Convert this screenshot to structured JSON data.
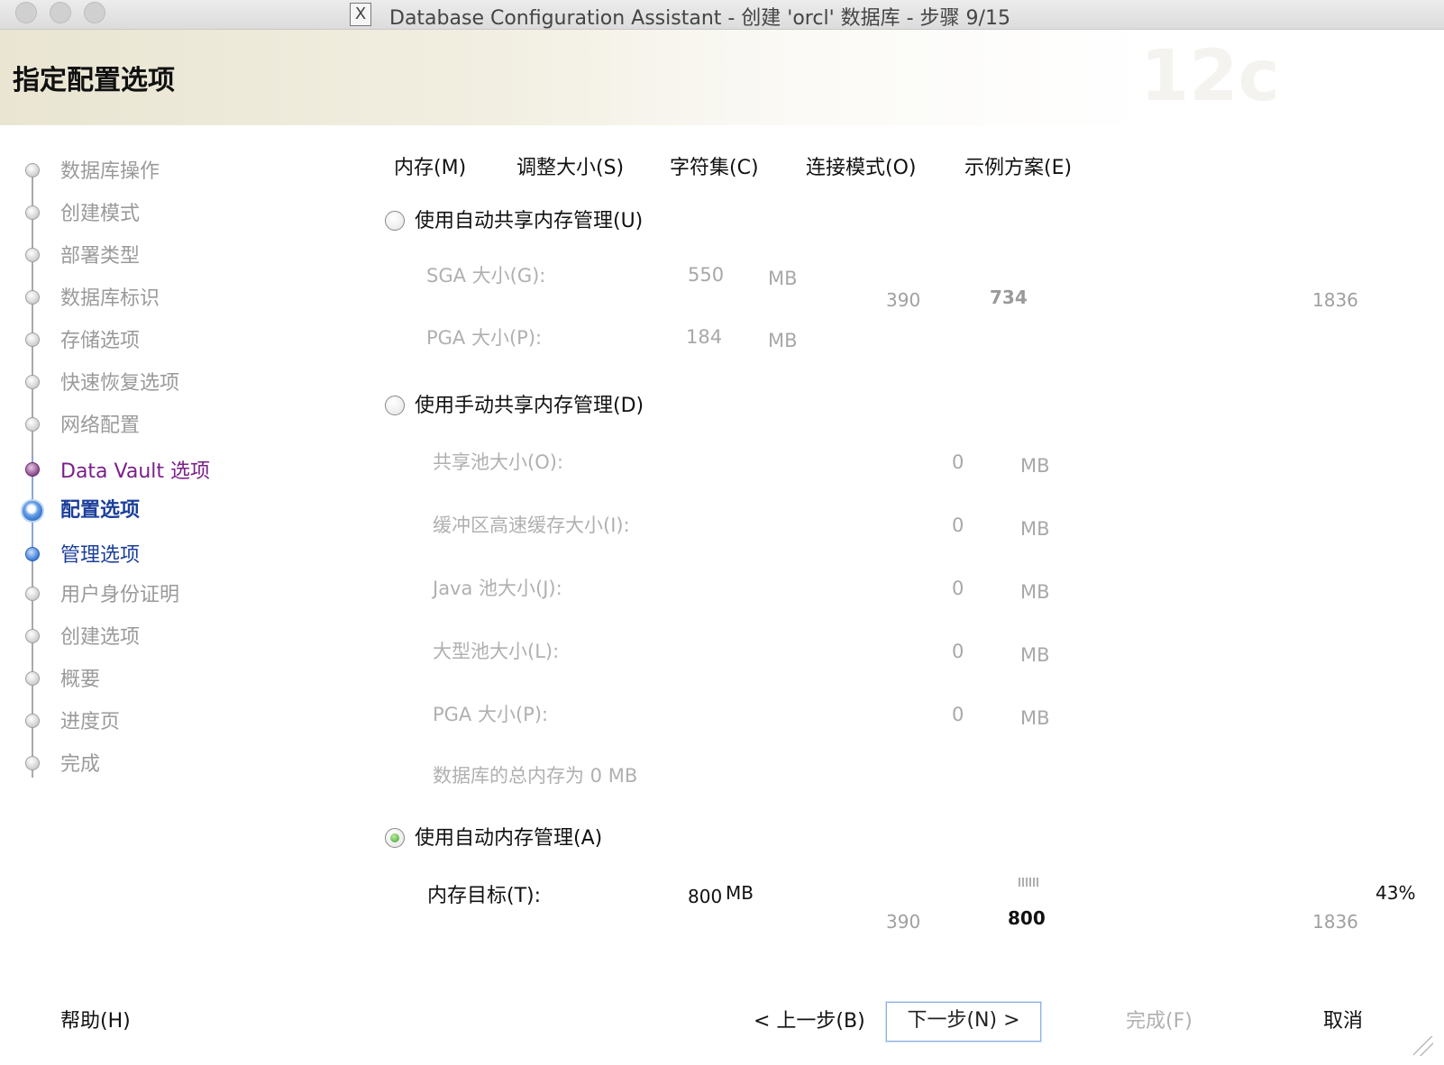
{
  "window": {
    "title": "Database Configuration Assistant - 创建 'orcl' 数据库 - 步骤 9/15",
    "title_icon": "X"
  },
  "header": {
    "title": "指定配置选项",
    "watermark": "12c"
  },
  "steps": [
    {
      "label": "数据库操作",
      "state": "done"
    },
    {
      "label": "创建模式",
      "state": "done"
    },
    {
      "label": "部署类型",
      "state": "done"
    },
    {
      "label": "数据库标识",
      "state": "done"
    },
    {
      "label": "存储选项",
      "state": "done"
    },
    {
      "label": "快速恢复选项",
      "state": "done"
    },
    {
      "label": "网络配置",
      "state": "done"
    },
    {
      "label": "Data Vault 选项",
      "state": "visited"
    },
    {
      "label": "配置选项",
      "state": "current"
    },
    {
      "label": "管理选项",
      "state": "next"
    },
    {
      "label": "用户身份证明",
      "state": "pending"
    },
    {
      "label": "创建选项",
      "state": "pending"
    },
    {
      "label": "概要",
      "state": "pending"
    },
    {
      "label": "进度页",
      "state": "pending"
    },
    {
      "label": "完成",
      "state": "pending"
    }
  ],
  "tabs": [
    {
      "label": "内存(M)"
    },
    {
      "label": "调整大小(S)"
    },
    {
      "label": "字符集(C)"
    },
    {
      "label": "连接模式(O)"
    },
    {
      "label": "示例方案(E)"
    }
  ],
  "memory": {
    "asmm": {
      "label": "使用自动共享内存管理(U)",
      "selected": false,
      "sga_label": "SGA 大小(G):",
      "sga_value": "550",
      "sga_unit": "MB",
      "pga_label": "PGA 大小(P):",
      "pga_value": "184",
      "pga_unit": "MB",
      "scale_min": "390",
      "scale_mid": "734",
      "scale_max": "1836"
    },
    "manual": {
      "label": "使用手动共享内存管理(D)",
      "selected": false,
      "fields": [
        {
          "label": "共享池大小(O):",
          "value": "0",
          "unit": "MB"
        },
        {
          "label": "缓冲区高速缓存大小(I):",
          "value": "0",
          "unit": "MB"
        },
        {
          "label": "Java 池大小(J):",
          "value": "0",
          "unit": "MB"
        },
        {
          "label": "大型池大小(L):",
          "value": "0",
          "unit": "MB"
        },
        {
          "label": "PGA 大小(P):",
          "value": "0",
          "unit": "MB"
        }
      ],
      "total_text": "数据库的总内存为 0 MB"
    },
    "amm": {
      "label": "使用自动内存管理(A)",
      "selected": true,
      "target_label": "内存目标(T):",
      "target_value": "800",
      "target_unit": "MB",
      "percent": "43%",
      "slider_value": 800,
      "scale_min": "390",
      "scale_mid": "800",
      "scale_max": "1836"
    }
  },
  "buttons": {
    "help": "帮助(H)",
    "back": "< 上一步(B)",
    "next": "下一步(N) >",
    "finish": "完成(F)",
    "cancel": "取消"
  }
}
